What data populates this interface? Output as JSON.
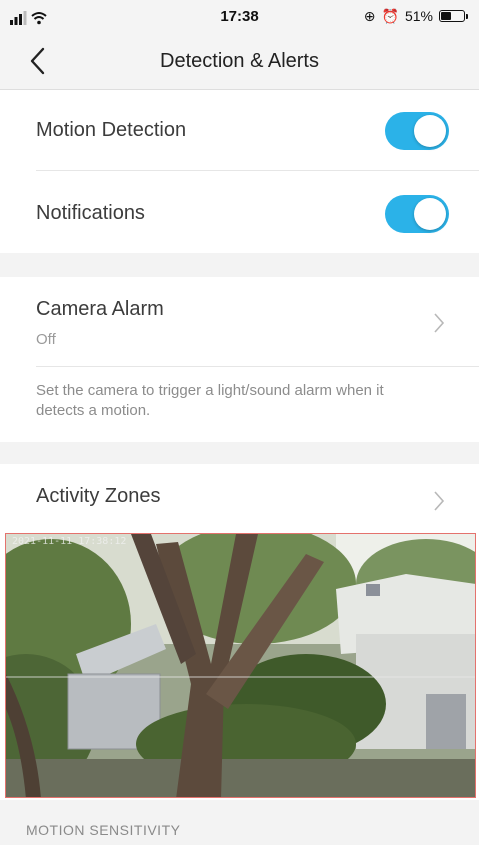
{
  "status_bar": {
    "time": "17:38",
    "battery_text": "51%",
    "battery_level": 0.51
  },
  "nav": {
    "title": "Detection & Alerts"
  },
  "settings": {
    "motion_detection": {
      "label": "Motion Detection",
      "enabled": true
    },
    "notifications": {
      "label": "Notifications",
      "enabled": true
    },
    "camera_alarm": {
      "label": "Camera Alarm",
      "value": "Off",
      "description": "Set the camera to trigger a light/sound alarm when it detects a motion."
    },
    "activity_zones": {
      "label": "Activity Zones"
    }
  },
  "camera_preview": {
    "overlay_text": "2021-11-11 17:38:12"
  },
  "section": {
    "motion_sensitivity": "MOTION SENSITIVITY"
  },
  "colors": {
    "toggle_on": "#2bb2e8",
    "zone_border": "#e4726d",
    "background_gray": "#f3f3f3"
  }
}
